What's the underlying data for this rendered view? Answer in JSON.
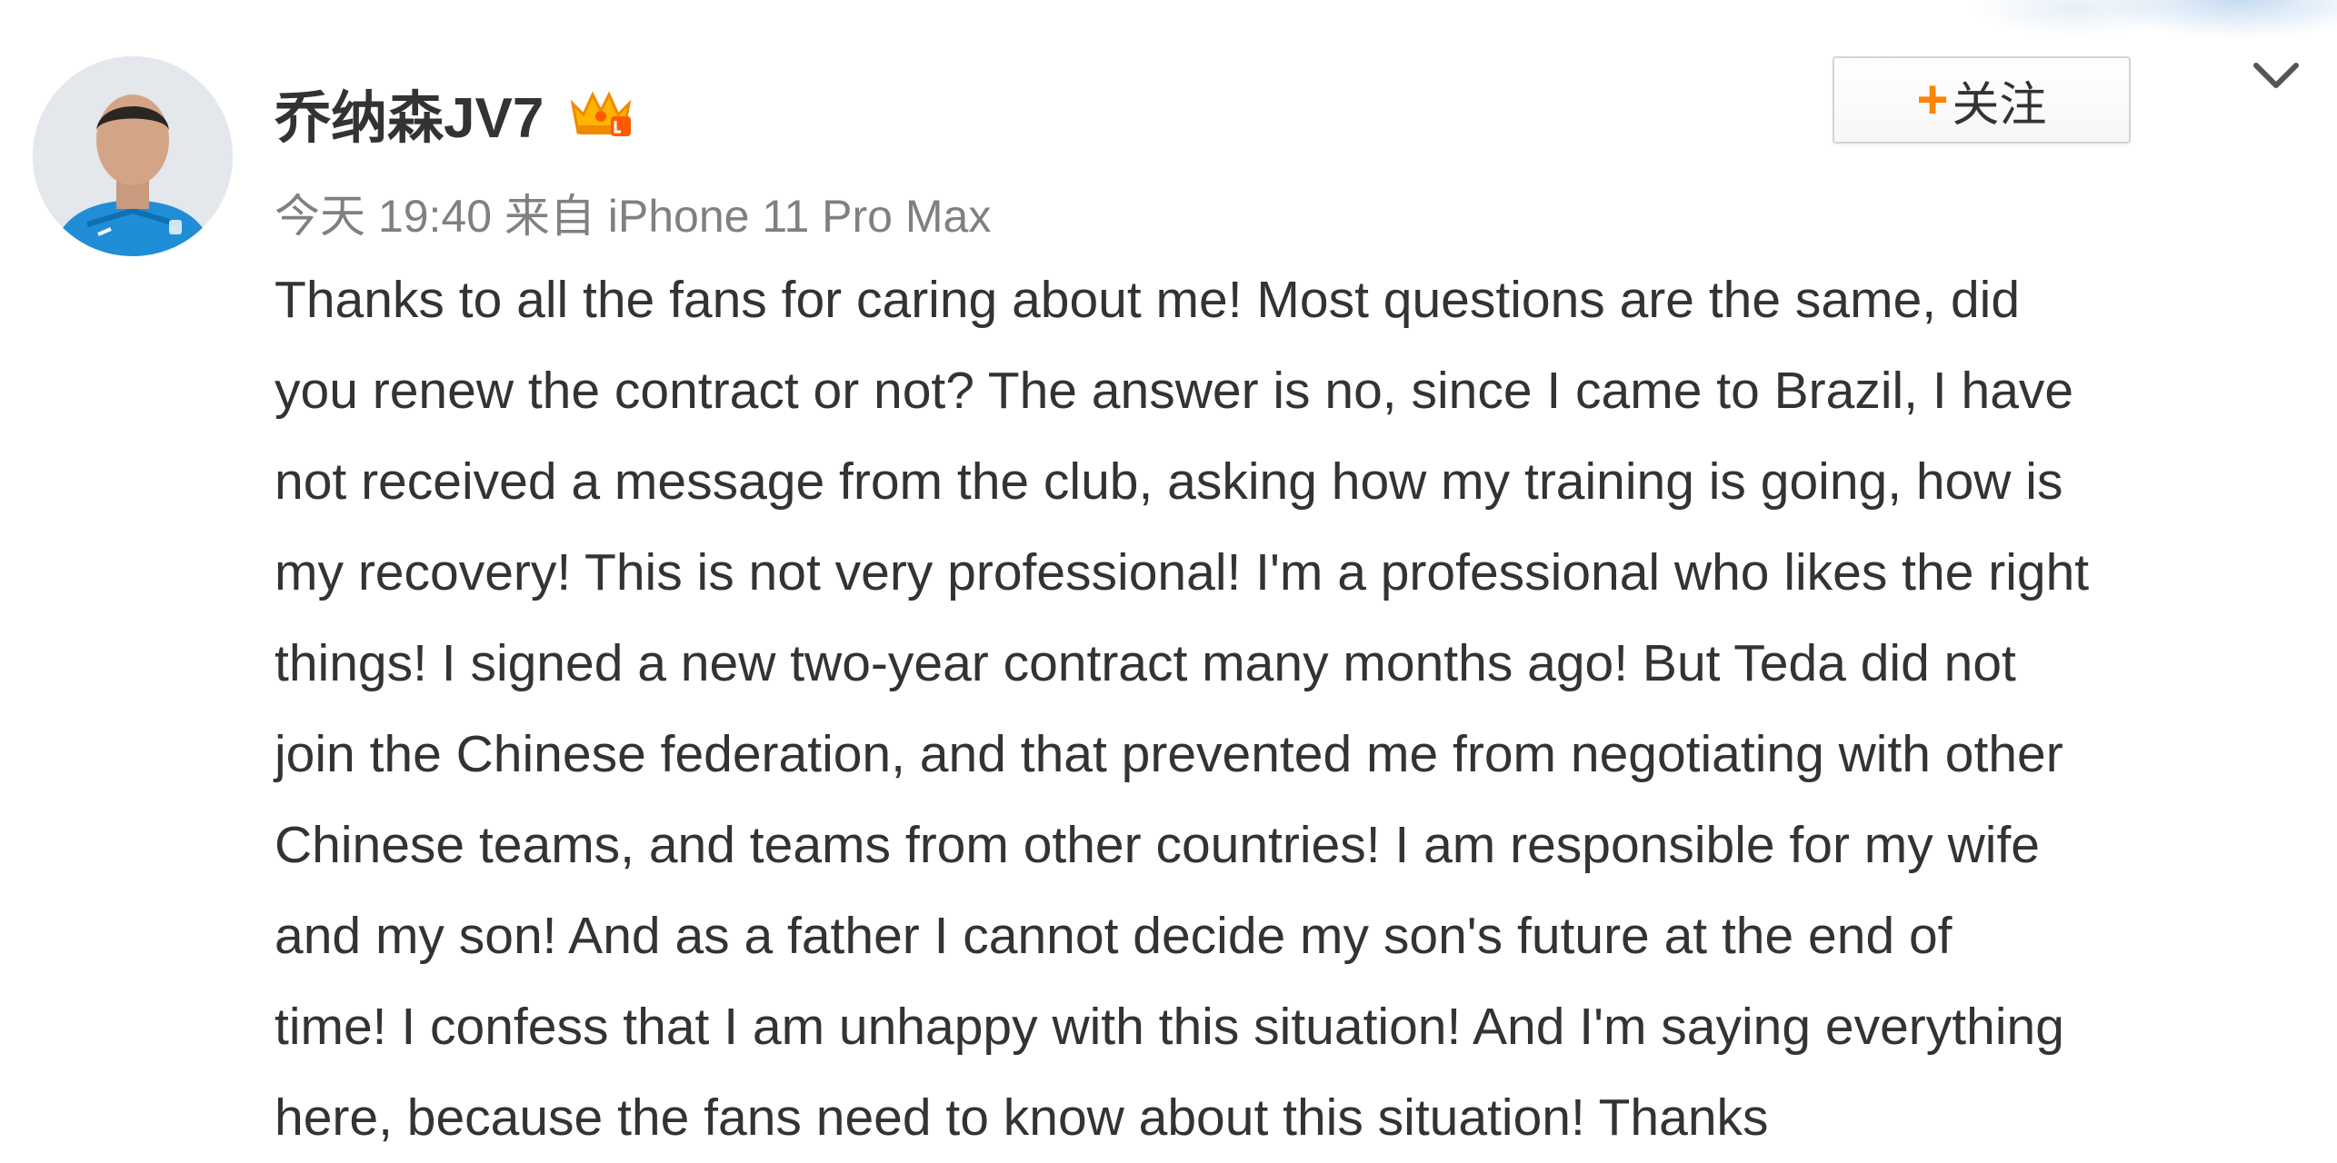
{
  "post": {
    "username": "乔纳森JV7",
    "badge_icon": "vip-crown-icon",
    "meta": "今天 19:40 来自 iPhone 11 Pro Max",
    "follow": {
      "plus": "+",
      "label": "关注"
    },
    "menu_icon": "chevron-down-icon",
    "text_lines": [
      "Thanks to all the fans for caring about me!  Most questions are the same, did",
      "you renew the contract or not?  The answer is no, since I came to Brazil, I have",
      "not received a message from the club, asking how my training is going, how is",
      "my recovery!  This is not very professional!  I'm a professional who likes the right",
      "things!  I signed a new two-year contract many months ago!  But Teda did not",
      "join the Chinese federation, and that prevented me from negotiating with other",
      "Chinese teams, and teams from other countries!  I am responsible for my wife",
      "and my son!  And as a father I cannot decide my son's future at the end of",
      "time!  I confess that I am unhappy with this situation!  And I'm saying everything",
      "here, because the fans need to know about this situation!  Thanks"
    ]
  },
  "colors": {
    "accent_orange": "#ff8200",
    "text": "#333333",
    "meta_text": "#808080"
  }
}
